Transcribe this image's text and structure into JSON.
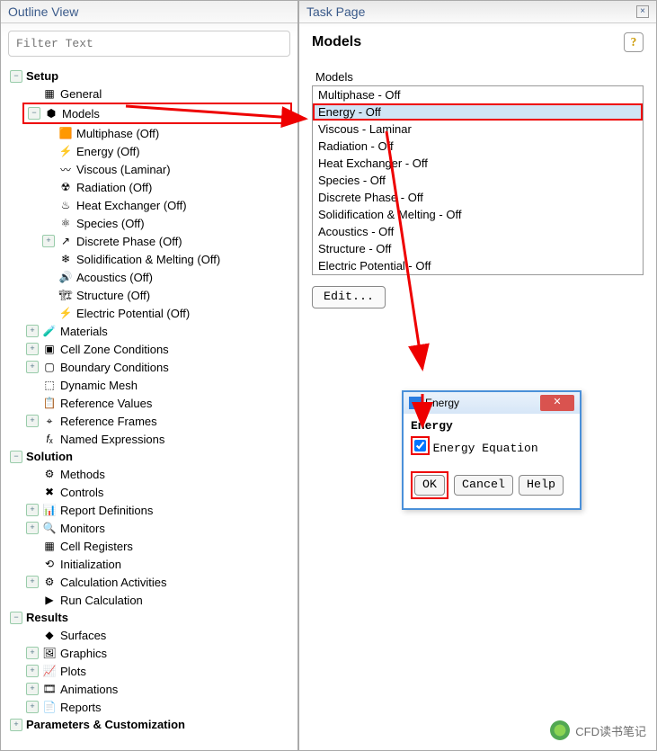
{
  "outline": {
    "header": "Outline View",
    "filter_placeholder": "Filter Text",
    "tree": {
      "setup": "Setup",
      "general": "General",
      "models": "Models",
      "multiphase": "Multiphase (Off)",
      "energy": "Energy (Off)",
      "viscous": "Viscous (Laminar)",
      "radiation": "Radiation (Off)",
      "heat_exchanger": "Heat Exchanger (Off)",
      "species": "Species (Off)",
      "discrete_phase": "Discrete Phase (Off)",
      "solidification": "Solidification & Melting (Off)",
      "acoustics": "Acoustics (Off)",
      "structure": "Structure (Off)",
      "electric_potential": "Electric Potential (Off)",
      "materials": "Materials",
      "cell_zone": "Cell Zone Conditions",
      "boundary": "Boundary Conditions",
      "dynamic_mesh": "Dynamic Mesh",
      "reference_values": "Reference Values",
      "reference_frames": "Reference Frames",
      "named_expressions": "Named Expressions",
      "solution": "Solution",
      "methods": "Methods",
      "controls": "Controls",
      "report_definitions": "Report Definitions",
      "monitors": "Monitors",
      "cell_registers": "Cell Registers",
      "initialization": "Initialization",
      "calculation_activities": "Calculation Activities",
      "run_calculation": "Run Calculation",
      "results": "Results",
      "surfaces": "Surfaces",
      "graphics": "Graphics",
      "plots": "Plots",
      "animations": "Animations",
      "reports": "Reports",
      "parameters": "Parameters & Customization"
    }
  },
  "task": {
    "header": "Task Page",
    "title": "Models",
    "list_label": "Models",
    "items": [
      "Multiphase - Off",
      "Energy - Off",
      "Viscous - Laminar",
      "Radiation - Off",
      "Heat Exchanger - Off",
      "Species - Off",
      "Discrete Phase - Off",
      "Solidification & Melting - Off",
      "Acoustics - Off",
      "Structure - Off",
      "Electric Potential - Off"
    ],
    "edit": "Edit..."
  },
  "dialog": {
    "title": "Energy",
    "section": "Energy",
    "checkbox_label": "Energy Equation",
    "ok": "OK",
    "cancel": "Cancel",
    "help": "Help"
  },
  "watermark": "CFD读书笔记"
}
